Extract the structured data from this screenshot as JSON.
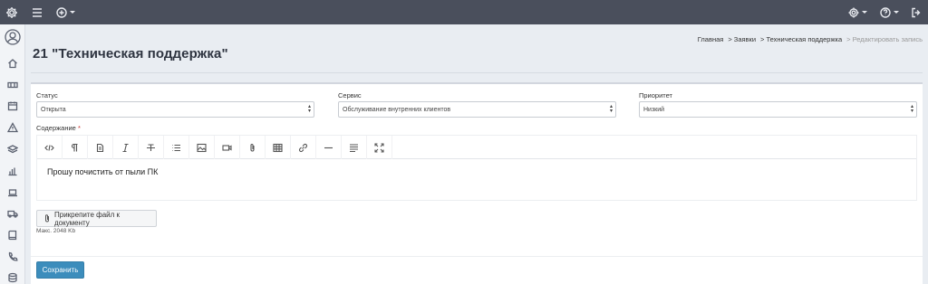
{
  "topbar": {
    "menu_icon": "hamburger-icon",
    "add_icon": "plus-circle-icon",
    "settings_icon": "gear-icon",
    "help_icon": "question-circle-icon",
    "logout_icon": "logout-icon"
  },
  "sidebar": {
    "items": [
      {
        "icon": "user-avatar-icon"
      },
      {
        "icon": "home-icon"
      },
      {
        "icon": "ticket-icon"
      },
      {
        "icon": "calendar-icon"
      },
      {
        "icon": "warning-icon"
      },
      {
        "icon": "layers-icon"
      },
      {
        "icon": "bar-chart-icon"
      },
      {
        "icon": "laptop-icon"
      },
      {
        "icon": "truck-icon"
      },
      {
        "icon": "book-icon"
      },
      {
        "icon": "phone-icon"
      },
      {
        "icon": "database-icon"
      }
    ]
  },
  "page": {
    "title": "21 \"Техническая поддержка\""
  },
  "breadcrumb": {
    "home": "Главная",
    "requests": "> Заявки",
    "support": "> Техническая поддержка",
    "current": "> Редактировать запись"
  },
  "form": {
    "status_label": "Статус",
    "status_value": "Открыта",
    "service_label": "Сервис",
    "service_value": "Обслуживание внутренних клиентов",
    "priority_label": "Приоритет",
    "priority_value": "Низкий",
    "content_label": "Содержание",
    "required_mark": "*",
    "content_text": "Прошу почистить от пыли ПК",
    "attach_label": "Прикрепите файл к документу",
    "max_size": "Макс. 2048 Kb",
    "save_label": "Сохранить"
  },
  "editor_toolbar": [
    "code-view-icon",
    "paragraph-icon",
    "format-icon",
    "italic-icon",
    "strikethrough-icon",
    "unordered-list-icon",
    "image-icon",
    "video-icon",
    "attachment-icon",
    "table-icon",
    "link-icon",
    "horizontal-rule-icon",
    "align-icon",
    "fullscreen-icon"
  ],
  "colors": {
    "topbar": "#4a4f5c",
    "primary_button": "#3c8dbc",
    "background": "#e9edf2"
  }
}
